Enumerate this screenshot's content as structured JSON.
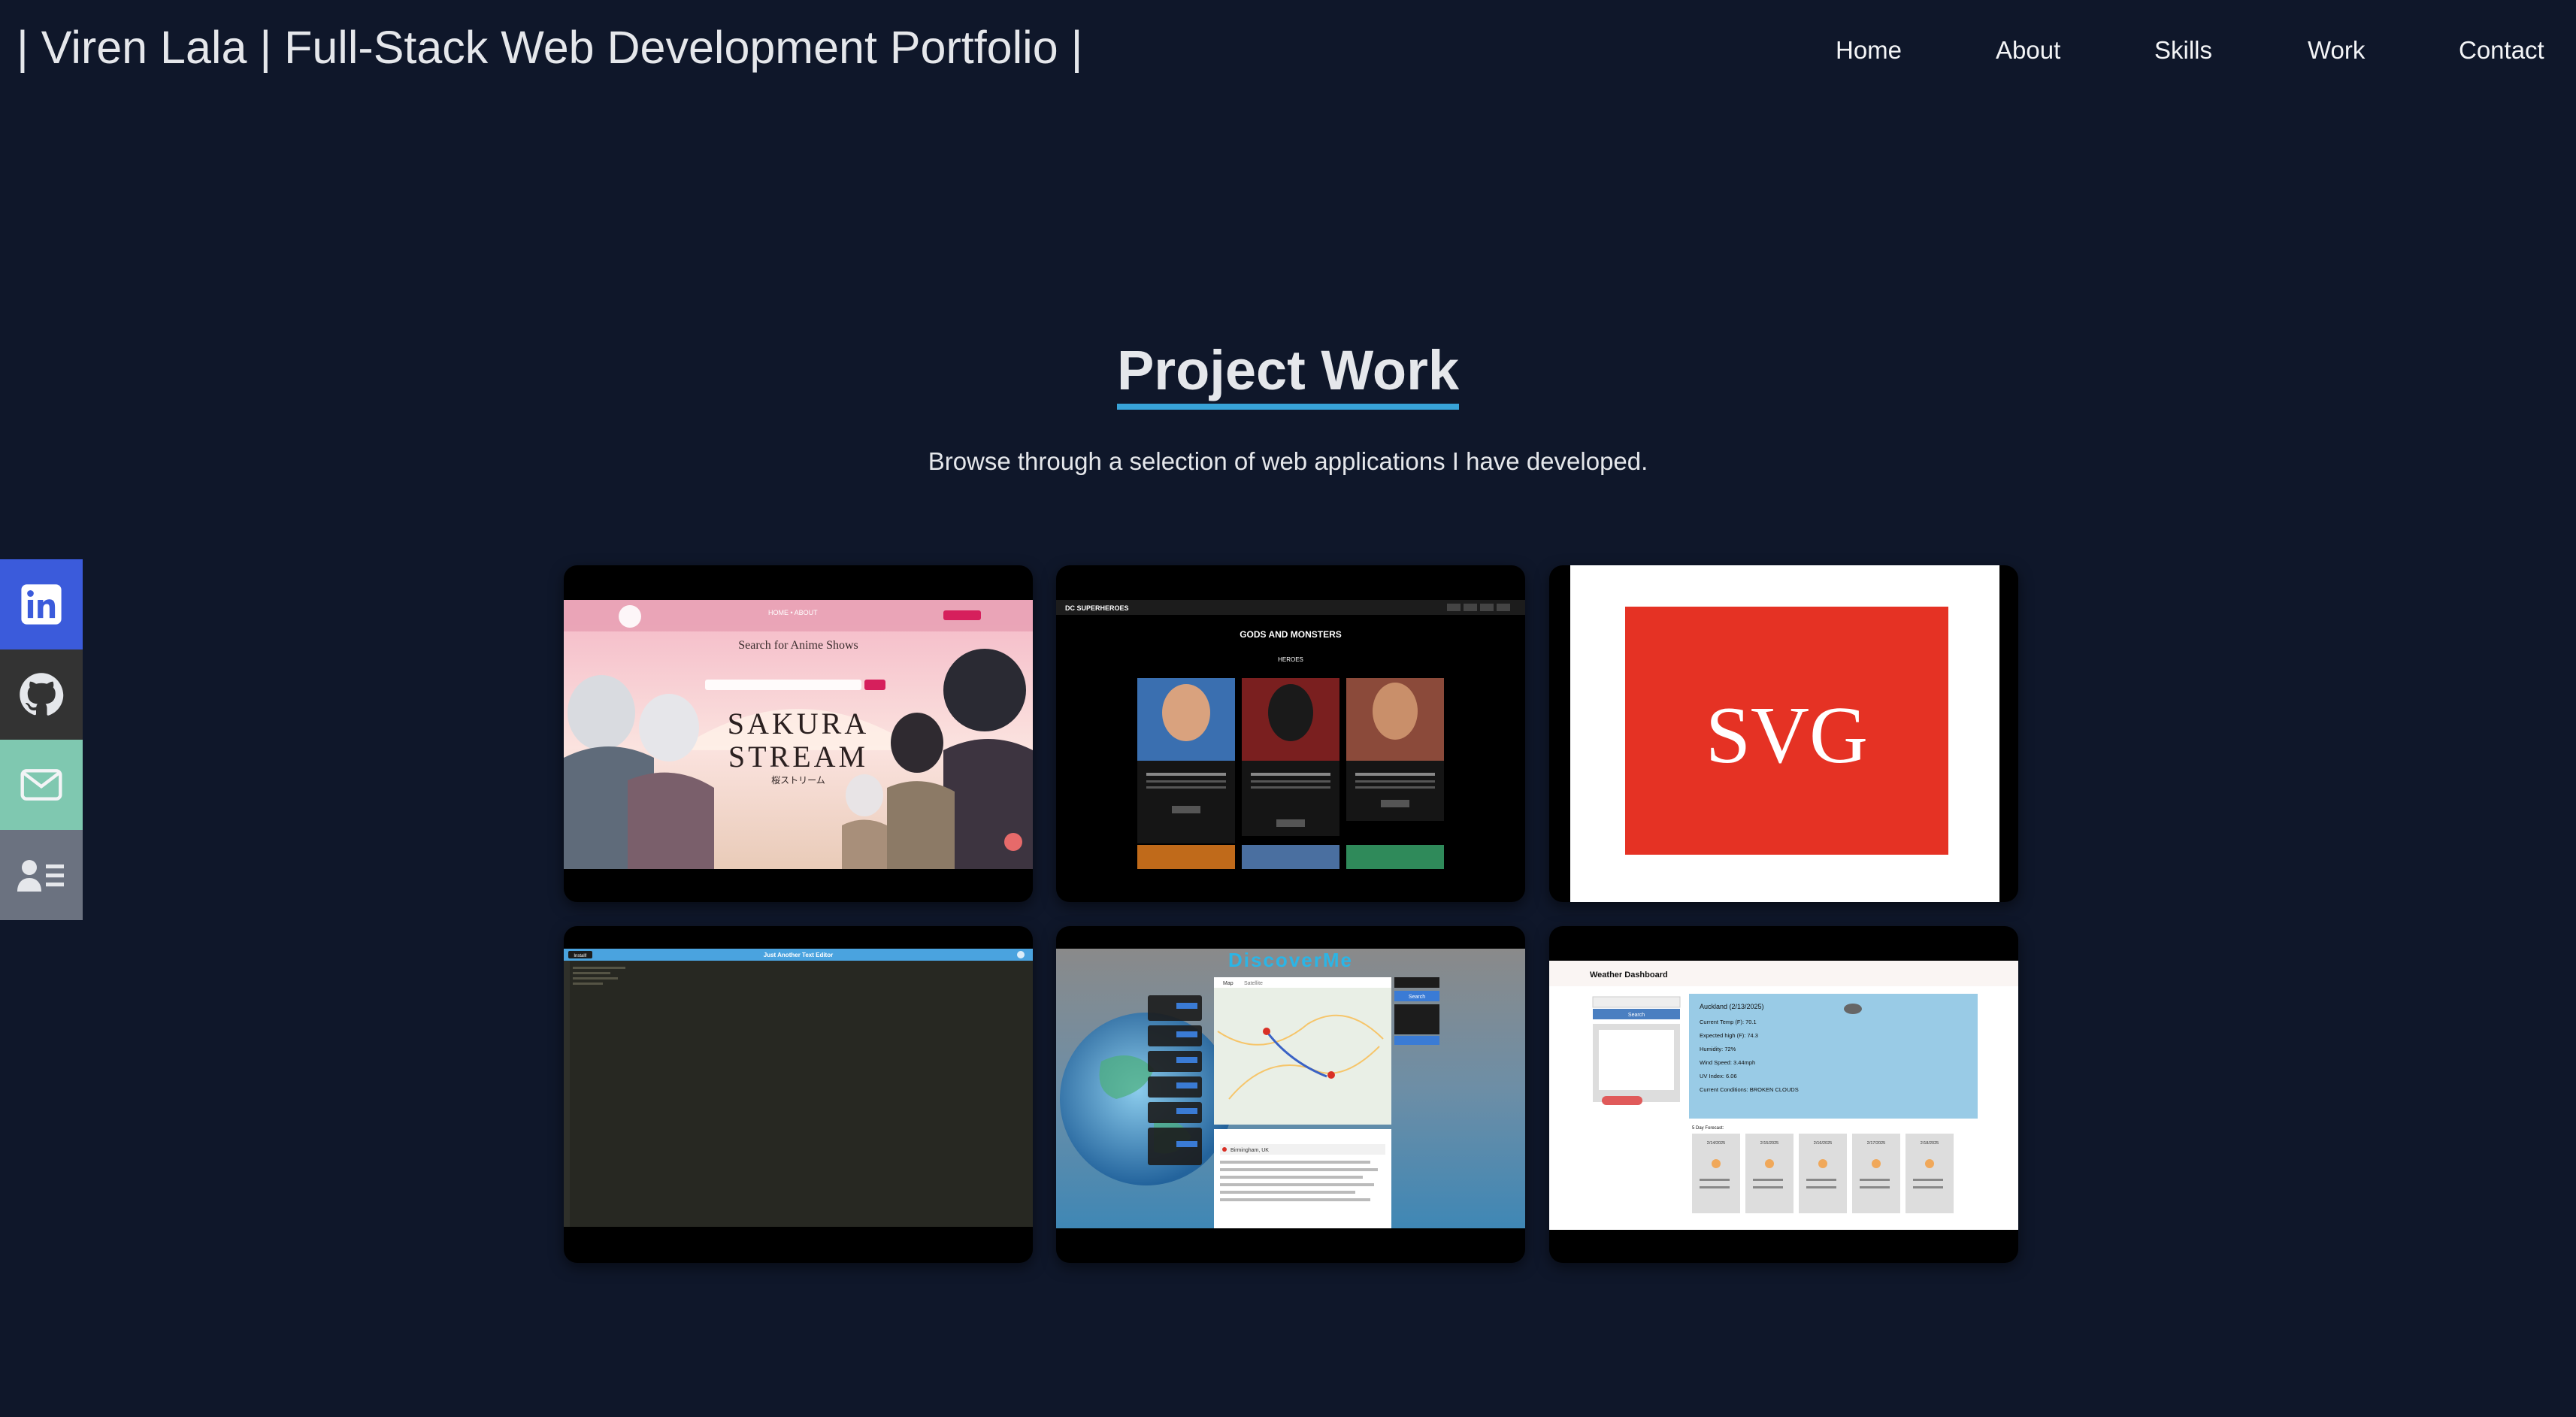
{
  "header": {
    "title": "| Viren Lala | Full-Stack Web Development Portfolio |",
    "nav": [
      "Home",
      "About",
      "Skills",
      "Work",
      "Contact"
    ]
  },
  "work": {
    "heading": "Project Work",
    "subtitle": "Browse through a selection of web applications I have developed."
  },
  "social": [
    {
      "icon": "linkedin-icon",
      "color": "#3b5bdb"
    },
    {
      "icon": "github-icon",
      "color": "#333333"
    },
    {
      "icon": "email-icon",
      "color": "#7fc8b0"
    },
    {
      "icon": "resume-icon",
      "color": "#6b7280"
    }
  ],
  "projects": [
    {
      "name": "sakura-stream",
      "screen": {
        "nav": "HOME  •  ABOUT",
        "heading": "Search for Anime Shows",
        "search_button": "Search",
        "logo_line1": "SAKURA",
        "logo_line2": "STREAM",
        "logo_jp": "桜ストリーム"
      }
    },
    {
      "name": "dc-superheroes",
      "screen": {
        "brand": "DC SUPERHEROES",
        "heading": "GODS AND MONSTERS",
        "subheading": "HEROES",
        "cards": [
          "SUPERMAN",
          "BATMAN",
          "WONDER WOMAN"
        ],
        "button": "Add to Favorites"
      }
    },
    {
      "name": "svg-logo-maker",
      "screen": {
        "logo_text": "SVG",
        "accent": "#e53224"
      }
    },
    {
      "name": "text-editor",
      "screen": {
        "install_button": "Install!",
        "title": "Just Another Text Editor"
      }
    },
    {
      "name": "discover-me",
      "screen": {
        "title": "DiscoverMe",
        "map_tab": "Map",
        "satellite_tab": "Satellite",
        "search_button": "Search",
        "location": "Birmingham, UK"
      }
    },
    {
      "name": "weather-dashboard",
      "screen": {
        "title": "Weather Dashboard",
        "search_button": "Search",
        "city_header": "Auckland (2/13/2025)",
        "stats": [
          "Current Temp (F): 70.1",
          "Expected high (F): 74.3",
          "Humidity: 72%",
          "Wind Speed: 3.44mph",
          "UV Index: 6.06",
          "Current Conditions: BROKEN CLOUDS"
        ],
        "forecast_label": "5 Day Forecast:",
        "forecast": [
          "2/14/2025",
          "2/15/2025",
          "2/16/2025",
          "2/17/2025",
          "2/18/2025"
        ]
      }
    }
  ]
}
